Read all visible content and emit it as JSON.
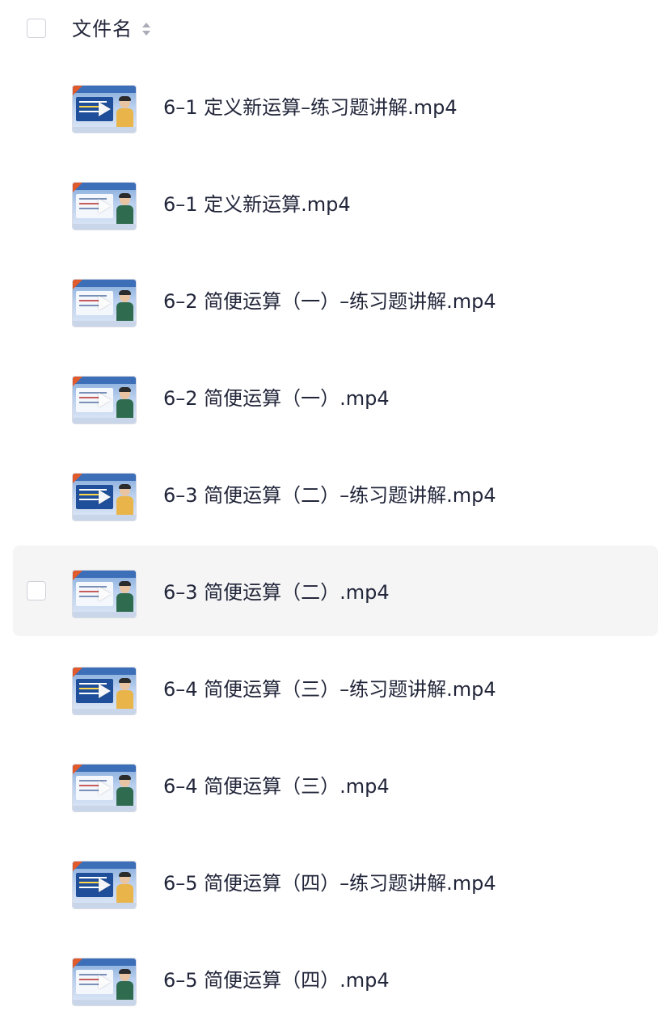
{
  "header": {
    "select_all_label": "",
    "column_label": "文件名",
    "sort_icon": "sort-icon"
  },
  "files": [
    {
      "name": "6–1 定义新运算–练习题讲解.mp4",
      "thumb_style": "cartoon",
      "hover": false
    },
    {
      "name": "6–1 定义新运算.mp4",
      "thumb_style": "teacher",
      "hover": false
    },
    {
      "name": "6–2 简便运算（一）–练习题讲解.mp4",
      "thumb_style": "board",
      "hover": false
    },
    {
      "name": "6–2 简便运算（一）.mp4",
      "thumb_style": "teacher",
      "hover": false
    },
    {
      "name": "6–3 简便运算（二）–练习题讲解.mp4",
      "thumb_style": "cartoon",
      "hover": false
    },
    {
      "name": "6–3 简便运算（二）.mp4",
      "thumb_style": "teacher",
      "hover": true
    },
    {
      "name": "6–4 简便运算（三）–练习题讲解.mp4",
      "thumb_style": "cartoon",
      "hover": false
    },
    {
      "name": "6–4 简便运算（三）.mp4",
      "thumb_style": "teacher",
      "hover": false
    },
    {
      "name": "6–5 简便运算（四）–练习题讲解.mp4",
      "thumb_style": "cartoon",
      "hover": false
    },
    {
      "name": "6–5 简便运算（四）.mp4",
      "thumb_style": "teacher",
      "hover": false
    }
  ],
  "colors": {
    "text": "#22263a",
    "hover_row": "#f5f5f6",
    "checkbox_border": "#cdd0d8"
  }
}
